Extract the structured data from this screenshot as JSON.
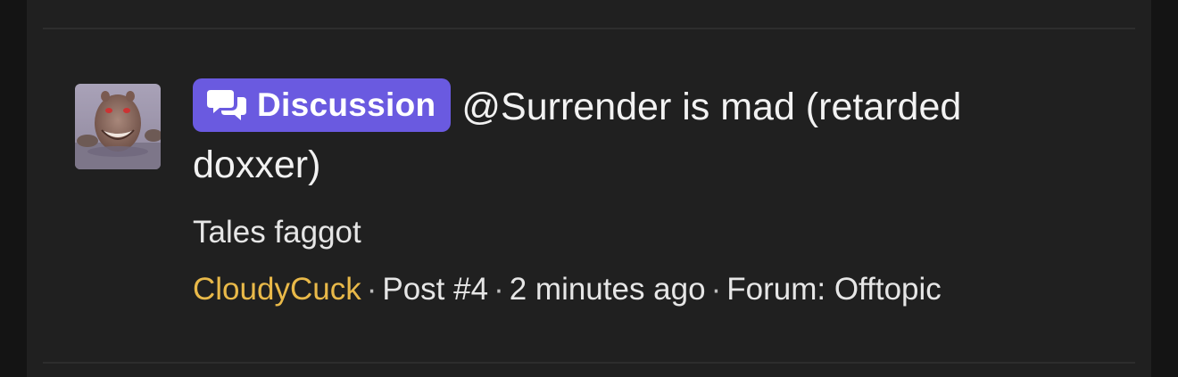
{
  "thread": {
    "prefix_label": "Discussion",
    "prefix_icon": "chat-bubbles-icon",
    "prefix_color": "#6a5ae0",
    "title": "@Surrender is mad (retarded doxxer)",
    "snippet": "Tales faggot",
    "author": "CloudyCuck",
    "author_color": "#e9b949",
    "post": "Post #4",
    "time": "2 minutes ago",
    "forum": "Forum: Offtopic",
    "separator": "·",
    "avatar_icon": "hippo-avatar-icon"
  }
}
